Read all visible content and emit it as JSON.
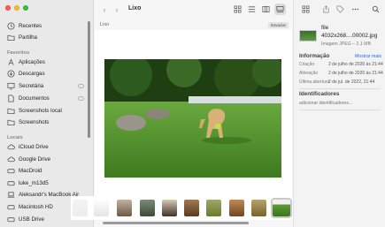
{
  "window": {
    "title": "Lixo"
  },
  "sidebar": {
    "top_items": [
      {
        "label": "Recentes",
        "icon": "clock-icon"
      },
      {
        "label": "Partilha",
        "icon": "shared-folder-icon"
      }
    ],
    "favorites_header": "Favoritos",
    "favorites": [
      {
        "label": "Aplicações",
        "icon": "applications-icon"
      },
      {
        "label": "Descargas",
        "icon": "downloads-icon"
      },
      {
        "label": "Secretária",
        "icon": "desktop-icon"
      },
      {
        "label": "Documentos",
        "icon": "documents-icon"
      },
      {
        "label": "Screenshots local",
        "icon": "folder-icon"
      },
      {
        "label": "Screenshots",
        "icon": "folder-icon"
      }
    ],
    "locations_header": "Locais",
    "locations": [
      {
        "label": "iCloud Drive",
        "icon": "cloud-icon"
      },
      {
        "label": "Google Drive",
        "icon": "cloud-icon"
      },
      {
        "label": "MacDroid",
        "icon": "disk-icon"
      },
      {
        "label": "luke_m13d5",
        "icon": "disk-icon"
      },
      {
        "label": "Aleksandr's MacBook Air",
        "icon": "laptop-icon"
      },
      {
        "label": "Macintosh HD",
        "icon": "disk-icon"
      },
      {
        "label": "USB Drive",
        "icon": "disk-icon"
      }
    ]
  },
  "pathbar": {
    "label": "Lixo",
    "empty_button": "Esvaziar"
  },
  "inspector": {
    "file_name_line1": "file",
    "file_name_line2": "4032x268....00002.jpg",
    "file_type": "Imagem JPEG – 2,1 MB",
    "info_header": "Informação",
    "show_more": "Mostrar mais",
    "rows": [
      {
        "key": "Criação",
        "value": "2 de julho de 2020 às 21:44"
      },
      {
        "key": "Alteração",
        "value": "2 de julho de 2020 às 21:44"
      },
      {
        "key": "Última abertura",
        "value": "2 de jul. de 2022, 21:44"
      }
    ],
    "tags_header": "Identificadores",
    "tags_placeholder": "adicionar identificadores..."
  },
  "colors": {
    "accent": "#2a6de2",
    "close": "#ff5f57",
    "minimize": "#febc2e",
    "zoom": "#28c840"
  }
}
